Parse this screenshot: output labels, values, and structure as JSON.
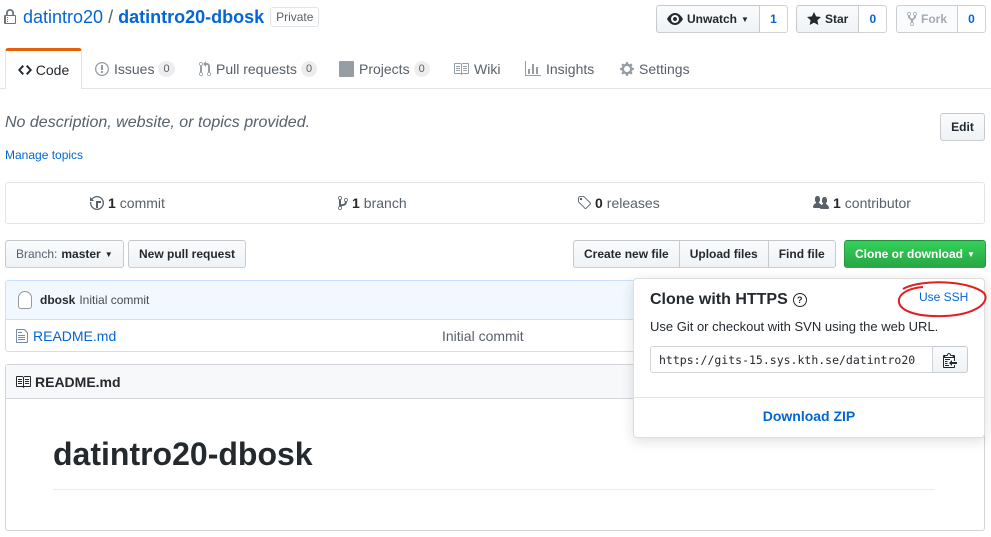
{
  "repo": {
    "owner": "datintro20",
    "separator": "/",
    "name": "datintro20-dbosk",
    "visibility": "Private"
  },
  "actions": {
    "unwatch_label": "Unwatch",
    "unwatch_count": "1",
    "star_label": "Star",
    "star_count": "0",
    "fork_label": "Fork",
    "fork_count": "0"
  },
  "tabs": [
    {
      "label": "Code",
      "icon": "code-icon"
    },
    {
      "label": "Issues",
      "count": "0",
      "icon": "issue-icon"
    },
    {
      "label": "Pull requests",
      "count": "0",
      "icon": "pull-request-icon"
    },
    {
      "label": "Projects",
      "count": "0",
      "icon": "project-icon"
    },
    {
      "label": "Wiki",
      "icon": "book-icon"
    },
    {
      "label": "Insights",
      "icon": "graph-icon"
    },
    {
      "label": "Settings",
      "icon": "gear-icon"
    }
  ],
  "description": {
    "text": "No description, website, or topics provided.",
    "edit_label": "Edit",
    "manage_topics": "Manage topics"
  },
  "summary": {
    "commits_num": "1",
    "commits_label": "commit",
    "branches_num": "1",
    "branches_label": "branch",
    "releases_num": "0",
    "releases_label": "releases",
    "contributors_num": "1",
    "contributors_label": "contributor"
  },
  "file_nav": {
    "branch_prefix": "Branch:",
    "branch_name": "master",
    "new_pr": "New pull request",
    "create_file": "Create new file",
    "upload_files": "Upload files",
    "find_file": "Find file",
    "clone_download": "Clone or download"
  },
  "commit_bar": {
    "author": "dbosk",
    "message": "Initial commit"
  },
  "files": [
    {
      "name": "README.md",
      "message": "Initial commit",
      "icon": "file-icon"
    }
  ],
  "readme": {
    "header": "README.md",
    "heading": "datintro20-dbosk"
  },
  "clone_popup": {
    "title": "Clone with HTTPS",
    "use_ssh": "Use SSH",
    "instructions": "Use Git or checkout with SVN using the web URL.",
    "url": "https://gits-15.sys.kth.se/datintro20",
    "download_zip": "Download ZIP"
  },
  "colors": {
    "link": "#0366d6",
    "green": "#28a745",
    "annotation_red": "#e02020",
    "tab_accent": "#e36209"
  }
}
